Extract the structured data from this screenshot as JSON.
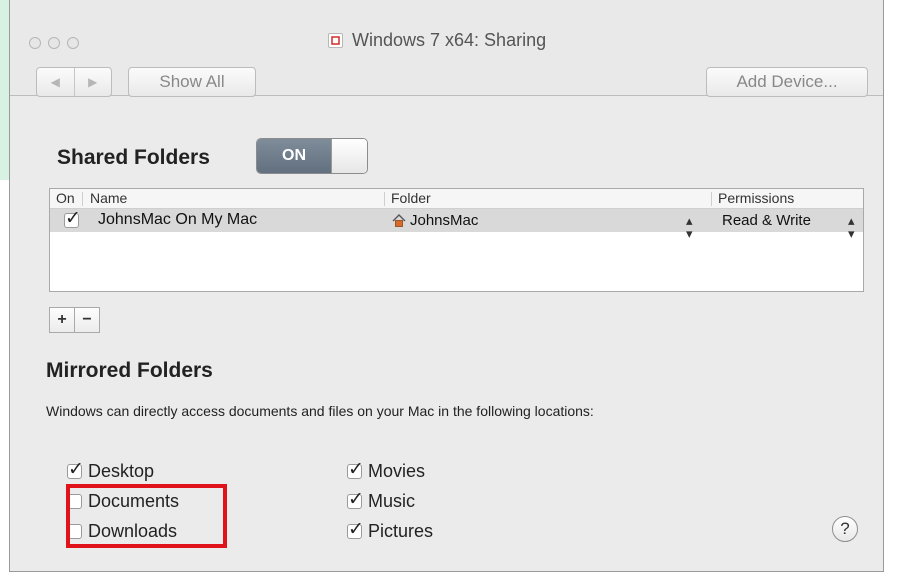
{
  "window": {
    "title": "Windows 7 x64: Sharing"
  },
  "toolbar": {
    "show_all_label": "Show All",
    "add_device_label": "Add Device..."
  },
  "shared_folders": {
    "title": "Shared Folders",
    "toggle_label": "ON",
    "columns": {
      "on": "On",
      "name": "Name",
      "folder": "Folder",
      "permissions": "Permissions"
    },
    "rows": [
      {
        "checked": true,
        "name": "JohnsMac On My Mac",
        "folder": "JohnsMac",
        "permissions": "Read & Write"
      }
    ],
    "add_label": "+",
    "remove_label": "−"
  },
  "mirrored_folders": {
    "title": "Mirrored Folders",
    "description": "Windows can directly access documents and files on your Mac in the following locations:",
    "left": [
      {
        "label": "Desktop",
        "checked": true
      },
      {
        "label": "Documents",
        "checked": false
      },
      {
        "label": "Downloads",
        "checked": false
      }
    ],
    "right": [
      {
        "label": "Movies",
        "checked": true
      },
      {
        "label": "Music",
        "checked": true
      },
      {
        "label": "Pictures",
        "checked": true
      }
    ]
  },
  "help_label": "?",
  "colors": {
    "highlight": "#e0131b",
    "toggle_on": "#6f7c8b"
  }
}
